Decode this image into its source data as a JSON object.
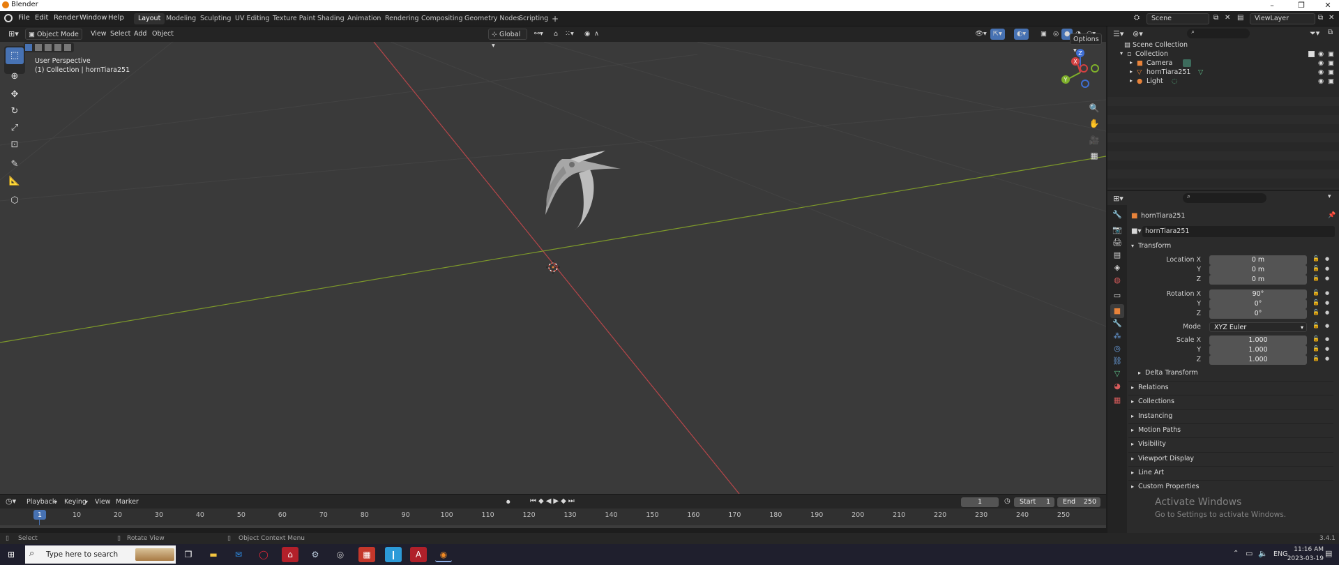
{
  "window": {
    "title": "Blender"
  },
  "menu": [
    "File",
    "Edit",
    "Render",
    "Window",
    "Help"
  ],
  "workspaces": [
    "Layout",
    "Modeling",
    "Sculpting",
    "UV Editing",
    "Texture Paint",
    "Shading",
    "Animation",
    "Rendering",
    "Compositing",
    "Geometry Nodes",
    "Scripting"
  ],
  "scene": {
    "name": "Scene",
    "view_layer": "ViewLayer"
  },
  "viewport": {
    "mode": "Object Mode",
    "menus": [
      "View",
      "Select",
      "Add",
      "Object"
    ],
    "orientation": "Global",
    "options": "Options",
    "perspective": "User Perspective",
    "collection_info": "(1) Collection | hornTiara251",
    "gizmo": {
      "x": "X",
      "y": "Y",
      "z": "Z"
    }
  },
  "outliner": {
    "scene_collection": "Scene Collection",
    "collection": "Collection",
    "items": [
      "Camera",
      "hornTiara251",
      "Light"
    ]
  },
  "properties": {
    "object_name": "hornTiara251",
    "data_name": "hornTiara251",
    "transform": {
      "title": "Transform",
      "location_label": "Location X",
      "location": [
        "0 m",
        "0 m",
        "0 m"
      ],
      "rotation_label": "Rotation X",
      "rotation": [
        "90°",
        "0°",
        "0°"
      ],
      "mode_label": "Mode",
      "mode": "XYZ Euler",
      "scale_label": "Scale X",
      "scale": [
        "1.000",
        "1.000",
        "1.000"
      ],
      "y": "Y",
      "z": "Z"
    },
    "delta_transform": "Delta Transform",
    "panels": [
      "Relations",
      "Collections",
      "Instancing",
      "Motion Paths",
      "Visibility",
      "Viewport Display",
      "Line Art",
      "Custom Properties"
    ]
  },
  "timeline": {
    "menus": [
      "Playback",
      "Keying",
      "View",
      "Marker"
    ],
    "current_frame": "1",
    "start_label": "Start",
    "start": "1",
    "end_label": "End",
    "end": "250",
    "ruler": [
      "1",
      "10",
      "20",
      "30",
      "40",
      "50",
      "60",
      "70",
      "80",
      "90",
      "100",
      "110",
      "120",
      "130",
      "140",
      "150",
      "160",
      "170",
      "180",
      "190",
      "200",
      "210",
      "220",
      "230",
      "240",
      "250"
    ]
  },
  "status": {
    "select": "Select",
    "rotate": "Rotate View",
    "context": "Object Context Menu",
    "version": "3.4.1"
  },
  "watermark": {
    "line1": "Activate Windows",
    "line2": "Go to Settings to activate Windows."
  },
  "taskbar": {
    "search": "Type here to search",
    "lang": "ENG",
    "time": "11:16 AM",
    "date": "2023-03-19"
  },
  "colors": {
    "accent": "#4772b3",
    "x_axis": "#c93f3f",
    "y_axis": "#8fb53c",
    "origin": "#e8833a"
  }
}
